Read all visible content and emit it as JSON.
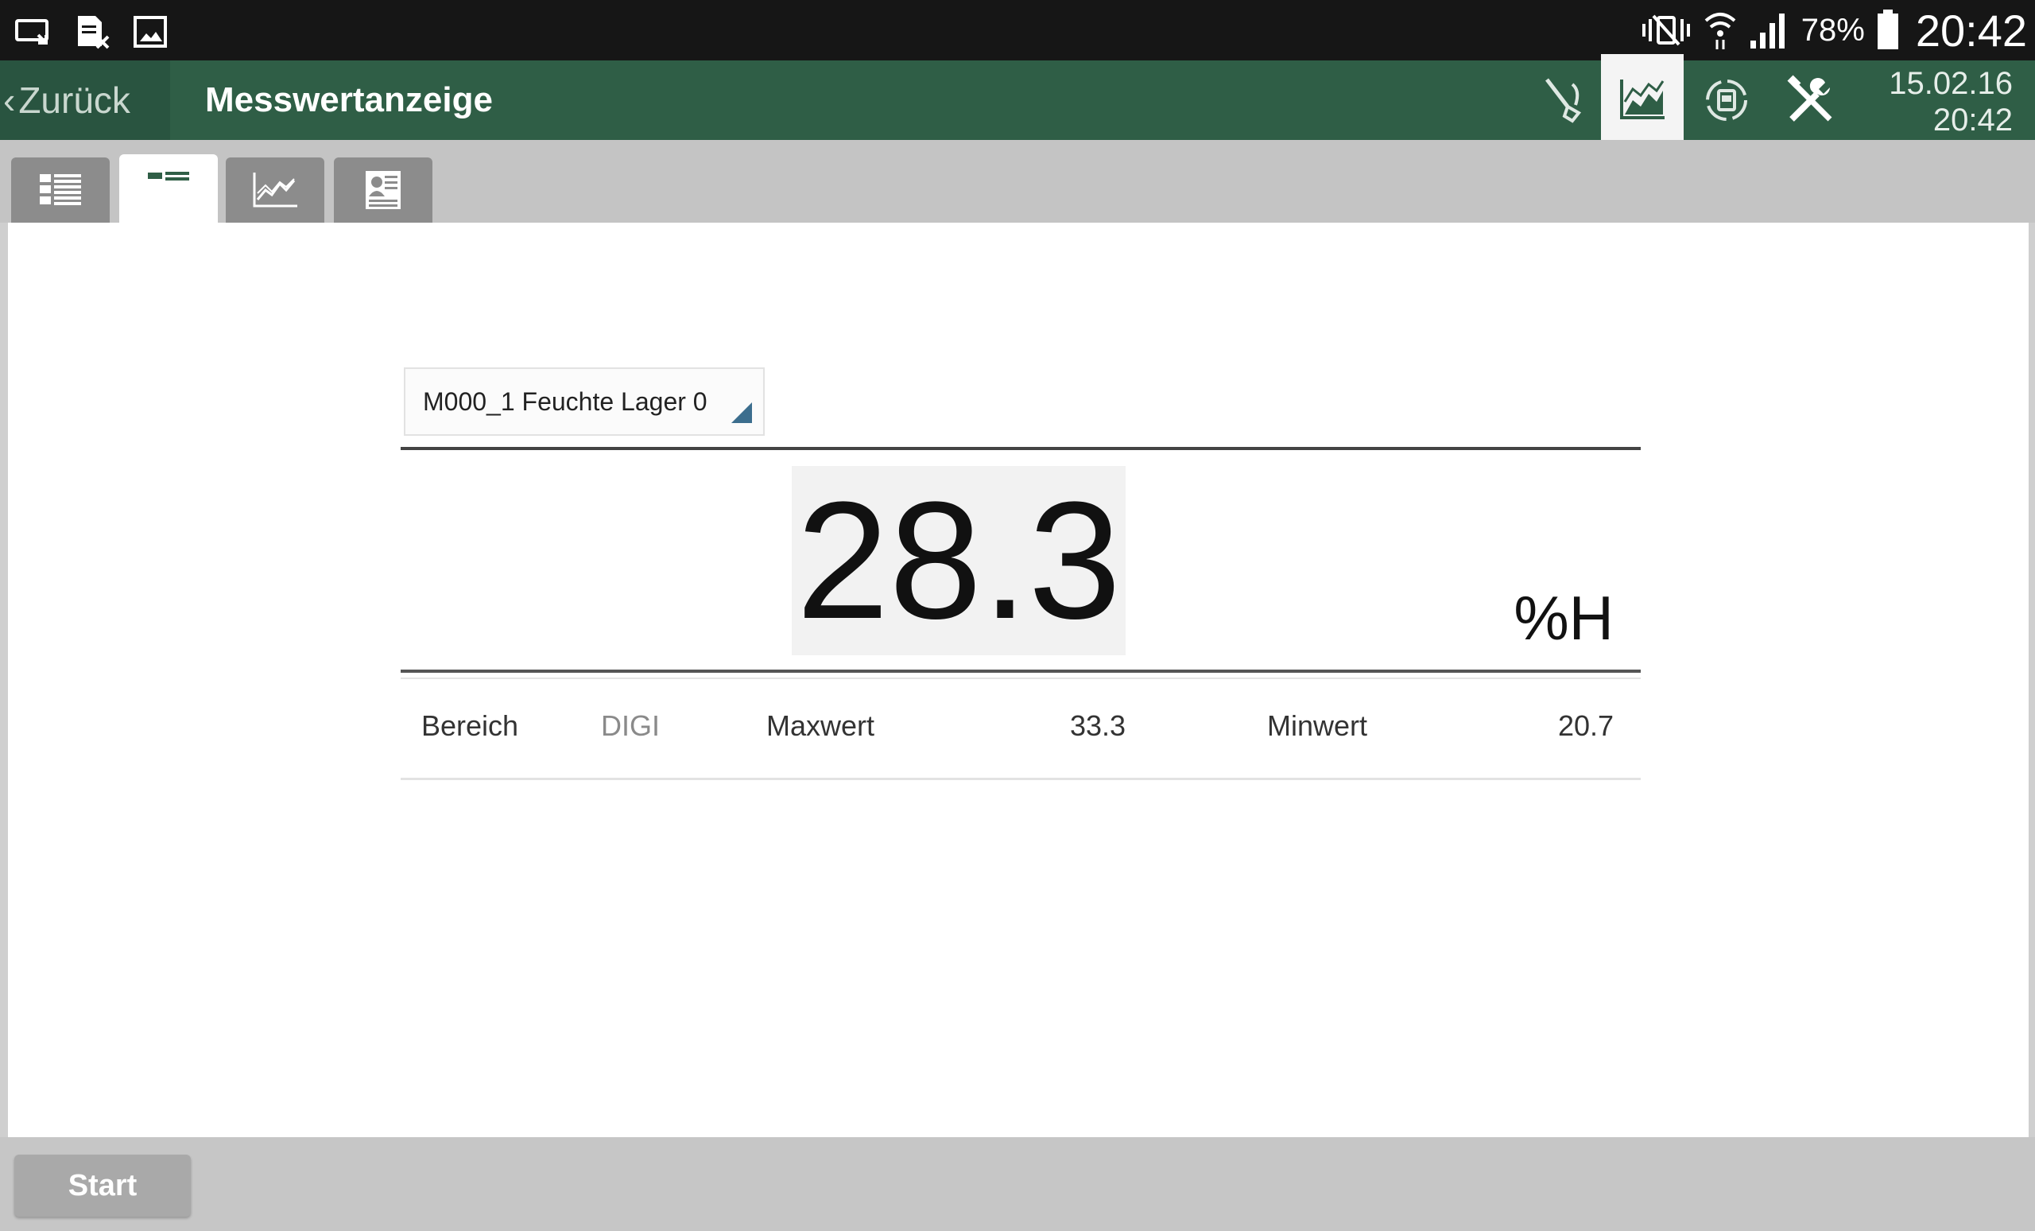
{
  "status_bar": {
    "battery_percent": "78%",
    "time": "20:42",
    "icons": [
      "screen-cast-icon",
      "document-x-icon",
      "image-icon",
      "mute-vibrate-icon",
      "wifi-icon",
      "signal-icon",
      "battery-icon"
    ]
  },
  "action_bar": {
    "back_label": "Zurück",
    "title": "Messwertanzeige",
    "icons": [
      "probe-icon",
      "chart-icon",
      "sync-icon",
      "tools-icon"
    ],
    "active_icon": "chart-icon",
    "date": "15.02.16",
    "time": "20:42"
  },
  "tabs": [
    {
      "icon": "list-icon",
      "active": false
    },
    {
      "icon": "single-value-icon",
      "active": true
    },
    {
      "icon": "line-chart-icon",
      "active": false
    },
    {
      "icon": "report-icon",
      "active": false
    }
  ],
  "measurement": {
    "channel": "M000_1 Feuchte Lager 0",
    "value": "28.3",
    "unit": "%H",
    "range_label": "Bereich",
    "range_value": "DIGI",
    "max_label": "Maxwert",
    "max_value": "33.3",
    "min_label": "Minwert",
    "min_value": "20.7"
  },
  "bottom_bar": {
    "start_label": "Start"
  },
  "colors": {
    "header_green": "#2f5e46",
    "back_green": "#295440",
    "status_bar": "#161616",
    "tab_inactive": "#8c8c8c",
    "select_triangle": "#3c6e8e"
  }
}
